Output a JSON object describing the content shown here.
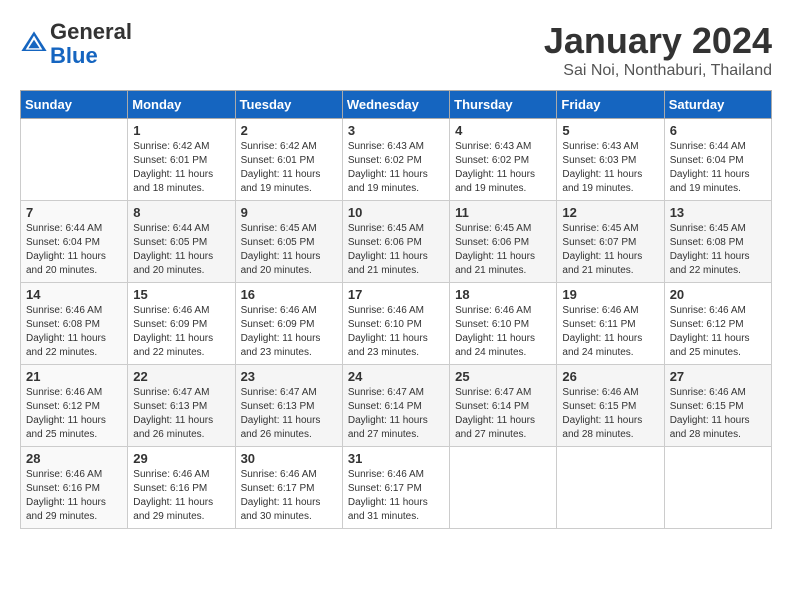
{
  "header": {
    "logo_general": "General",
    "logo_blue": "Blue",
    "month_title": "January 2024",
    "location": "Sai Noi, Nonthaburi, Thailand"
  },
  "days_of_week": [
    "Sunday",
    "Monday",
    "Tuesday",
    "Wednesday",
    "Thursday",
    "Friday",
    "Saturday"
  ],
  "weeks": [
    [
      {
        "num": "",
        "sunrise": "",
        "sunset": "",
        "daylight": ""
      },
      {
        "num": "1",
        "sunrise": "Sunrise: 6:42 AM",
        "sunset": "Sunset: 6:01 PM",
        "daylight": "Daylight: 11 hours and 18 minutes."
      },
      {
        "num": "2",
        "sunrise": "Sunrise: 6:42 AM",
        "sunset": "Sunset: 6:01 PM",
        "daylight": "Daylight: 11 hours and 19 minutes."
      },
      {
        "num": "3",
        "sunrise": "Sunrise: 6:43 AM",
        "sunset": "Sunset: 6:02 PM",
        "daylight": "Daylight: 11 hours and 19 minutes."
      },
      {
        "num": "4",
        "sunrise": "Sunrise: 6:43 AM",
        "sunset": "Sunset: 6:02 PM",
        "daylight": "Daylight: 11 hours and 19 minutes."
      },
      {
        "num": "5",
        "sunrise": "Sunrise: 6:43 AM",
        "sunset": "Sunset: 6:03 PM",
        "daylight": "Daylight: 11 hours and 19 minutes."
      },
      {
        "num": "6",
        "sunrise": "Sunrise: 6:44 AM",
        "sunset": "Sunset: 6:04 PM",
        "daylight": "Daylight: 11 hours and 19 minutes."
      }
    ],
    [
      {
        "num": "7",
        "sunrise": "Sunrise: 6:44 AM",
        "sunset": "Sunset: 6:04 PM",
        "daylight": "Daylight: 11 hours and 20 minutes."
      },
      {
        "num": "8",
        "sunrise": "Sunrise: 6:44 AM",
        "sunset": "Sunset: 6:05 PM",
        "daylight": "Daylight: 11 hours and 20 minutes."
      },
      {
        "num": "9",
        "sunrise": "Sunrise: 6:45 AM",
        "sunset": "Sunset: 6:05 PM",
        "daylight": "Daylight: 11 hours and 20 minutes."
      },
      {
        "num": "10",
        "sunrise": "Sunrise: 6:45 AM",
        "sunset": "Sunset: 6:06 PM",
        "daylight": "Daylight: 11 hours and 21 minutes."
      },
      {
        "num": "11",
        "sunrise": "Sunrise: 6:45 AM",
        "sunset": "Sunset: 6:06 PM",
        "daylight": "Daylight: 11 hours and 21 minutes."
      },
      {
        "num": "12",
        "sunrise": "Sunrise: 6:45 AM",
        "sunset": "Sunset: 6:07 PM",
        "daylight": "Daylight: 11 hours and 21 minutes."
      },
      {
        "num": "13",
        "sunrise": "Sunrise: 6:45 AM",
        "sunset": "Sunset: 6:08 PM",
        "daylight": "Daylight: 11 hours and 22 minutes."
      }
    ],
    [
      {
        "num": "14",
        "sunrise": "Sunrise: 6:46 AM",
        "sunset": "Sunset: 6:08 PM",
        "daylight": "Daylight: 11 hours and 22 minutes."
      },
      {
        "num": "15",
        "sunrise": "Sunrise: 6:46 AM",
        "sunset": "Sunset: 6:09 PM",
        "daylight": "Daylight: 11 hours and 22 minutes."
      },
      {
        "num": "16",
        "sunrise": "Sunrise: 6:46 AM",
        "sunset": "Sunset: 6:09 PM",
        "daylight": "Daylight: 11 hours and 23 minutes."
      },
      {
        "num": "17",
        "sunrise": "Sunrise: 6:46 AM",
        "sunset": "Sunset: 6:10 PM",
        "daylight": "Daylight: 11 hours and 23 minutes."
      },
      {
        "num": "18",
        "sunrise": "Sunrise: 6:46 AM",
        "sunset": "Sunset: 6:10 PM",
        "daylight": "Daylight: 11 hours and 24 minutes."
      },
      {
        "num": "19",
        "sunrise": "Sunrise: 6:46 AM",
        "sunset": "Sunset: 6:11 PM",
        "daylight": "Daylight: 11 hours and 24 minutes."
      },
      {
        "num": "20",
        "sunrise": "Sunrise: 6:46 AM",
        "sunset": "Sunset: 6:12 PM",
        "daylight": "Daylight: 11 hours and 25 minutes."
      }
    ],
    [
      {
        "num": "21",
        "sunrise": "Sunrise: 6:46 AM",
        "sunset": "Sunset: 6:12 PM",
        "daylight": "Daylight: 11 hours and 25 minutes."
      },
      {
        "num": "22",
        "sunrise": "Sunrise: 6:47 AM",
        "sunset": "Sunset: 6:13 PM",
        "daylight": "Daylight: 11 hours and 26 minutes."
      },
      {
        "num": "23",
        "sunrise": "Sunrise: 6:47 AM",
        "sunset": "Sunset: 6:13 PM",
        "daylight": "Daylight: 11 hours and 26 minutes."
      },
      {
        "num": "24",
        "sunrise": "Sunrise: 6:47 AM",
        "sunset": "Sunset: 6:14 PM",
        "daylight": "Daylight: 11 hours and 27 minutes."
      },
      {
        "num": "25",
        "sunrise": "Sunrise: 6:47 AM",
        "sunset": "Sunset: 6:14 PM",
        "daylight": "Daylight: 11 hours and 27 minutes."
      },
      {
        "num": "26",
        "sunrise": "Sunrise: 6:46 AM",
        "sunset": "Sunset: 6:15 PM",
        "daylight": "Daylight: 11 hours and 28 minutes."
      },
      {
        "num": "27",
        "sunrise": "Sunrise: 6:46 AM",
        "sunset": "Sunset: 6:15 PM",
        "daylight": "Daylight: 11 hours and 28 minutes."
      }
    ],
    [
      {
        "num": "28",
        "sunrise": "Sunrise: 6:46 AM",
        "sunset": "Sunset: 6:16 PM",
        "daylight": "Daylight: 11 hours and 29 minutes."
      },
      {
        "num": "29",
        "sunrise": "Sunrise: 6:46 AM",
        "sunset": "Sunset: 6:16 PM",
        "daylight": "Daylight: 11 hours and 29 minutes."
      },
      {
        "num": "30",
        "sunrise": "Sunrise: 6:46 AM",
        "sunset": "Sunset: 6:17 PM",
        "daylight": "Daylight: 11 hours and 30 minutes."
      },
      {
        "num": "31",
        "sunrise": "Sunrise: 6:46 AM",
        "sunset": "Sunset: 6:17 PM",
        "daylight": "Daylight: 11 hours and 31 minutes."
      },
      {
        "num": "",
        "sunrise": "",
        "sunset": "",
        "daylight": ""
      },
      {
        "num": "",
        "sunrise": "",
        "sunset": "",
        "daylight": ""
      },
      {
        "num": "",
        "sunrise": "",
        "sunset": "",
        "daylight": ""
      }
    ]
  ]
}
